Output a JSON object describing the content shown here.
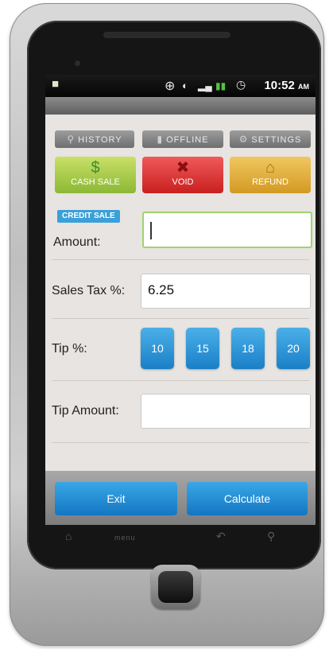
{
  "status_bar": {
    "time": "10:52",
    "ampm": "AM",
    "icons": [
      "message-icon",
      "gps-icon",
      "wifi-icon",
      "signal-icon",
      "battery-icon",
      "alarm-icon"
    ]
  },
  "top_buttons": [
    {
      "label": "HISTORY",
      "icon": "search-icon"
    },
    {
      "label": "OFFLINE",
      "icon": "bars-icon"
    },
    {
      "label": "SETTINGS",
      "icon": "gear-icon"
    }
  ],
  "action_tiles": [
    {
      "label": "CASH SALE",
      "icon": "dollar-icon"
    },
    {
      "label": "VOID",
      "icon": "x-icon"
    },
    {
      "label": "REFUND",
      "icon": "home-icon"
    }
  ],
  "form": {
    "sale_type_badge": "CREDIT SALE",
    "amount_label": "Amount:",
    "amount_value": "",
    "tax_label": "Sales Tax %:",
    "tax_value": "6.25",
    "tip_label": "Tip %:",
    "tip_options": [
      "10",
      "15",
      "18",
      "20"
    ],
    "tip_amount_label": "Tip Amount:",
    "tip_amount_value": ""
  },
  "bottom_buttons": {
    "exit": "Exit",
    "calculate": "Calculate"
  },
  "softkeys": {
    "menu": "menu"
  },
  "colors": {
    "accent_blue": "#1a7fc7",
    "cash_green": "#8cb834",
    "void_red": "#c91f1f",
    "refund_orange": "#d29a22"
  }
}
